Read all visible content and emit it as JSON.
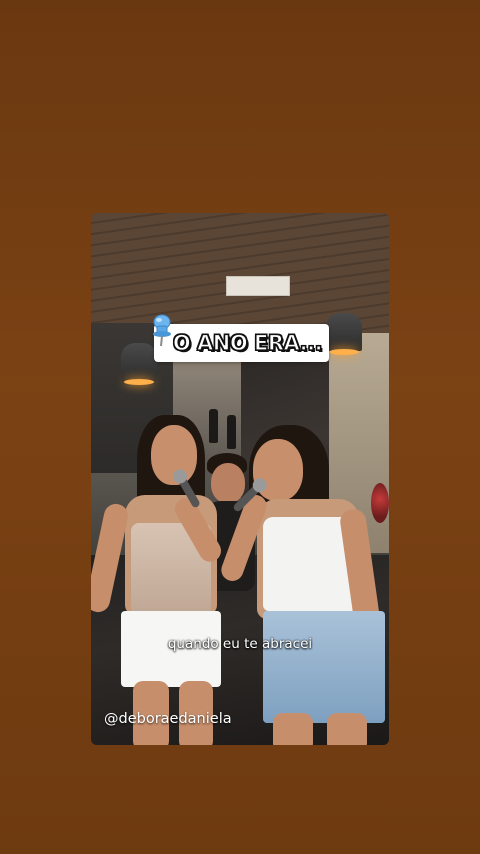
{
  "story": {
    "title_sticker": "O ANO ERA...",
    "caption": "quando eu te abracei",
    "handle": "@deboraedaniela"
  },
  "icons": {
    "sticker_icon": "pushpin-icon"
  },
  "colors": {
    "background": "#7b4214",
    "sticker_bg": "#ffffff",
    "pin": "#5aa8e6"
  }
}
